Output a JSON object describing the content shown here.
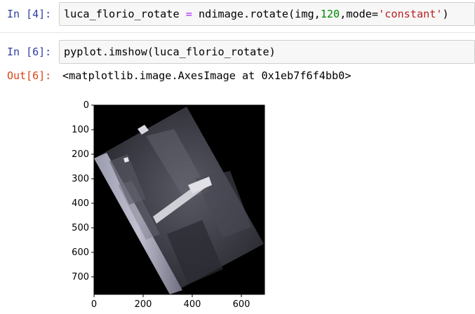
{
  "cell4": {
    "prompt": "In [4]:",
    "code_var": "luca_florio_rotate",
    "code_eq": " = ",
    "code_call": "ndimage.rotate(img,",
    "code_num": "120",
    "code_kw": ",mode=",
    "code_str": "'constant'",
    "code_close": ")"
  },
  "cell6": {
    "prompt": "In [6]:",
    "code": "pyplot.imshow(luca_florio_rotate)",
    "out_prompt": "Out[6]:",
    "output": "<matplotlib.image.AxesImage at 0x1eb7f6f4bb0>"
  },
  "plot": {
    "y_ticks": [
      "0",
      "100",
      "200",
      "300",
      "400",
      "500",
      "600",
      "700"
    ],
    "x_ticks": [
      "0",
      "200",
      "400",
      "600"
    ],
    "background": "#000000"
  },
  "colors": {
    "in_prompt": "#303f9f",
    "out_prompt": "#d84315",
    "string": "#ba2121",
    "number": "#008800",
    "cell_bg": "#f7f7f7"
  }
}
